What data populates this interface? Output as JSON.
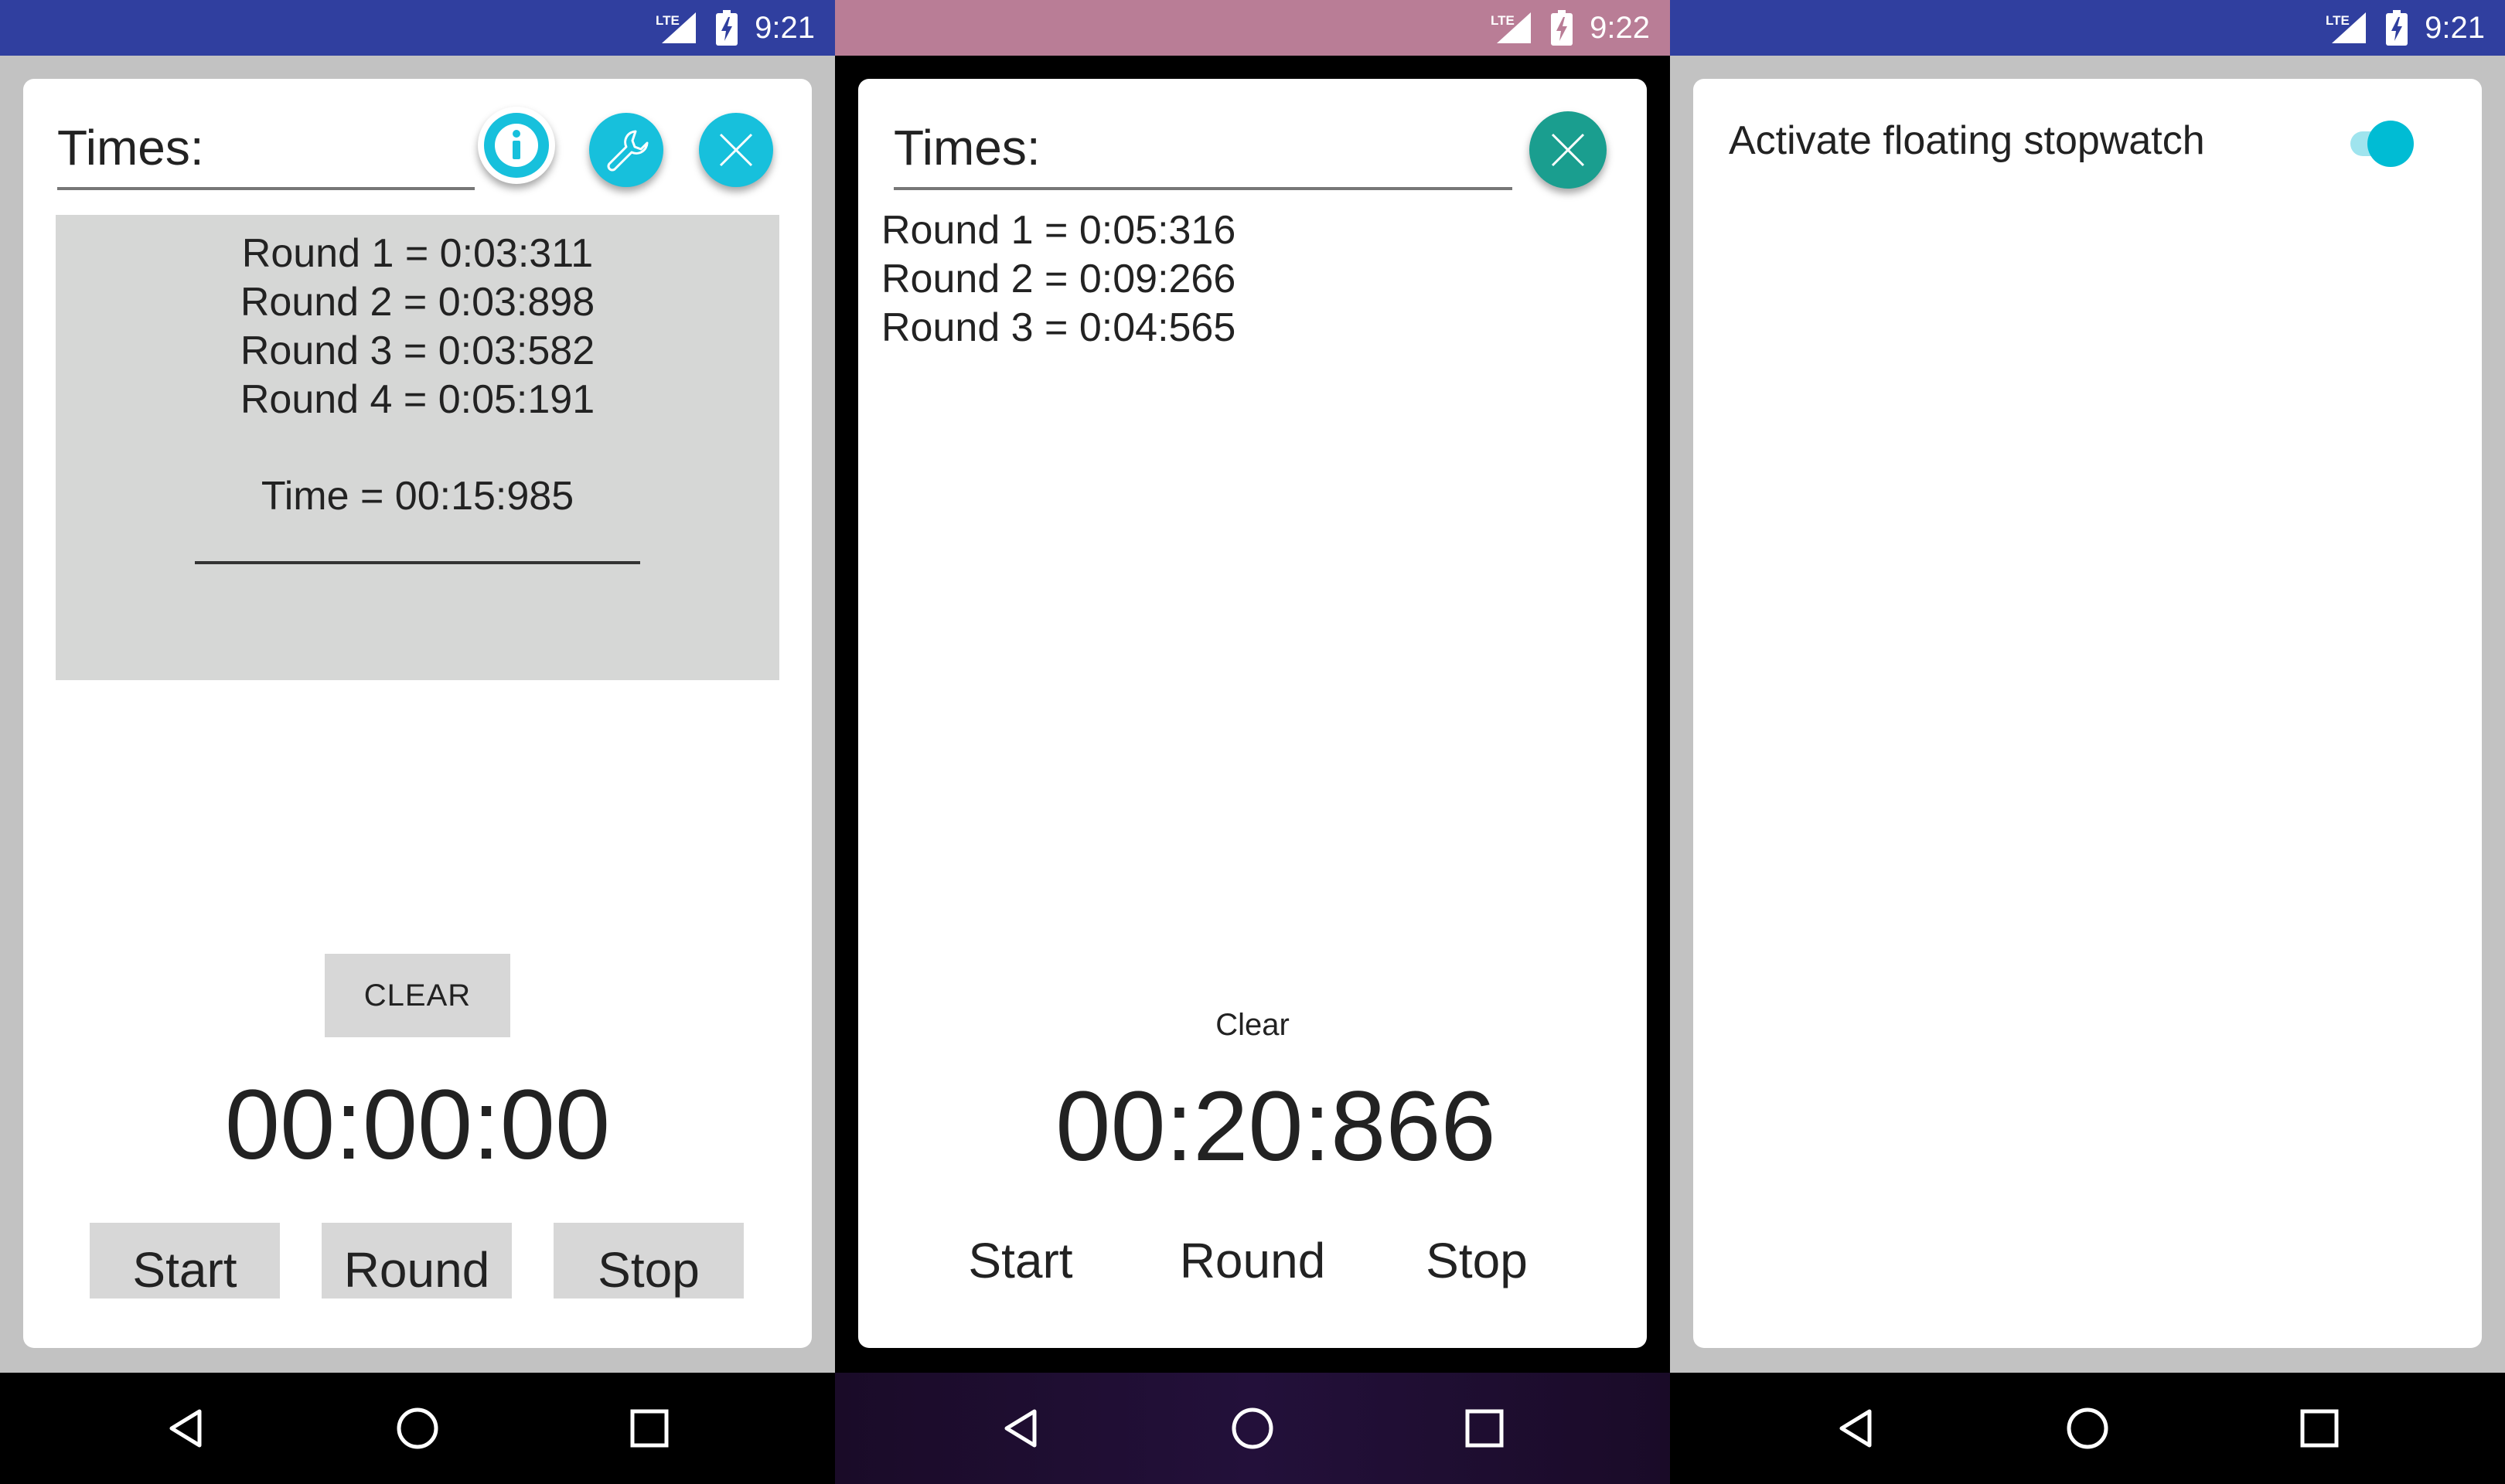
{
  "status_bar": {
    "network": "LTE",
    "screens": [
      {
        "time": "9:21"
      },
      {
        "time": "9:22"
      },
      {
        "time": "9:21"
      }
    ]
  },
  "screen1": {
    "times_label": "Times:",
    "rounds": [
      "Round 1 = 0:03:311",
      "Round 2 = 0:03:898",
      "Round 3 = 0:03:582",
      "Round 4 = 0:05:191"
    ],
    "total": "Time = 00:15:985",
    "clear_label": "CLEAR",
    "timer": "00:00:00",
    "start_label": "Start",
    "round_label": "Round",
    "stop_label": "Stop",
    "fab_icons": [
      "info-icon",
      "wrench-icon",
      "close-icon"
    ],
    "accent": "#17c0dc"
  },
  "screen2": {
    "times_label": "Times:",
    "rounds": [
      "Round 1 = 0:05:316",
      "Round 2 = 0:09:266",
      "Round 3 = 0:04:565"
    ],
    "clear_label": "Clear",
    "timer": "00:20:866",
    "start_label": "Start",
    "round_label": "Round",
    "stop_label": "Stop",
    "fab_icon": "close-icon",
    "accent": "#1a9e8f"
  },
  "screen3": {
    "setting_label": "Activate floating stopwatch",
    "toggle_on": true,
    "accent": "#00bcd4"
  },
  "navigation": {
    "icons": [
      "back-icon",
      "home-icon",
      "recents-icon"
    ]
  }
}
